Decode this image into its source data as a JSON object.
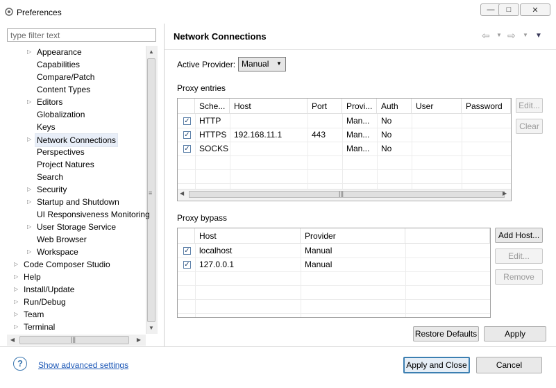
{
  "window": {
    "title": "Preferences",
    "minimize_glyph": "—",
    "maximize_glyph": "□",
    "close_glyph": "✕"
  },
  "filter": {
    "placeholder": "type filter text"
  },
  "tree": {
    "items": [
      {
        "label": "Appearance",
        "expandable": true,
        "level": 1
      },
      {
        "label": "Capabilities",
        "expandable": false,
        "level": 1
      },
      {
        "label": "Compare/Patch",
        "expandable": false,
        "level": 1
      },
      {
        "label": "Content Types",
        "expandable": false,
        "level": 1
      },
      {
        "label": "Editors",
        "expandable": true,
        "level": 1
      },
      {
        "label": "Globalization",
        "expandable": false,
        "level": 1
      },
      {
        "label": "Keys",
        "expandable": false,
        "level": 1
      },
      {
        "label": "Network Connections",
        "expandable": true,
        "level": 1,
        "selected": true
      },
      {
        "label": "Perspectives",
        "expandable": false,
        "level": 1
      },
      {
        "label": "Project Natures",
        "expandable": false,
        "level": 1
      },
      {
        "label": "Search",
        "expandable": false,
        "level": 1
      },
      {
        "label": "Security",
        "expandable": true,
        "level": 1
      },
      {
        "label": "Startup and Shutdown",
        "expandable": true,
        "level": 1
      },
      {
        "label": "UI Responsiveness Monitoring",
        "expandable": false,
        "level": 1
      },
      {
        "label": "User Storage Service",
        "expandable": true,
        "level": 1
      },
      {
        "label": "Web Browser",
        "expandable": false,
        "level": 1
      },
      {
        "label": "Workspace",
        "expandable": true,
        "level": 1
      },
      {
        "label": "Code Composer Studio",
        "expandable": true,
        "level": 0
      },
      {
        "label": "Help",
        "expandable": true,
        "level": 0
      },
      {
        "label": "Install/Update",
        "expandable": true,
        "level": 0
      },
      {
        "label": "Run/Debug",
        "expandable": true,
        "level": 0
      },
      {
        "label": "Team",
        "expandable": true,
        "level": 0
      },
      {
        "label": "Terminal",
        "expandable": true,
        "level": 0
      }
    ]
  },
  "page": {
    "title": "Network Connections",
    "active_provider_label": "Active Provider:",
    "active_provider_value": "Manual",
    "proxy_entries_label": "Proxy entries",
    "proxy_entries": {
      "columns": [
        "Sche...",
        "Host",
        "Port",
        "Provi...",
        "Auth",
        "User",
        "Password"
      ],
      "rows": [
        {
          "checked": true,
          "scheme": "HTTP",
          "host": "",
          "port": "",
          "provider": "Man...",
          "auth": "No",
          "user": "",
          "password": ""
        },
        {
          "checked": true,
          "scheme": "HTTPS",
          "host": "192.168.11.1",
          "port": "443",
          "provider": "Man...",
          "auth": "No",
          "user": "",
          "password": ""
        },
        {
          "checked": true,
          "scheme": "SOCKS",
          "host": "",
          "port": "",
          "provider": "Man...",
          "auth": "No",
          "user": "",
          "password": ""
        }
      ]
    },
    "entries_buttons": {
      "edit": "Edit...",
      "clear": "Clear"
    },
    "proxy_bypass_label": "Proxy bypass",
    "proxy_bypass": {
      "columns": [
        "Host",
        "Provider"
      ],
      "rows": [
        {
          "checked": true,
          "host": "localhost",
          "provider": "Manual"
        },
        {
          "checked": true,
          "host": "127.0.0.1",
          "provider": "Manual"
        }
      ]
    },
    "bypass_buttons": {
      "add_host": "Add Host...",
      "edit": "Edit...",
      "remove": "Remove"
    },
    "restore_defaults": "Restore Defaults",
    "apply": "Apply"
  },
  "footer": {
    "help_glyph": "?",
    "advanced_link": "Show advanced settings",
    "apply_and_close": "Apply and Close",
    "cancel": "Cancel"
  },
  "colors": {
    "link": "#1a56b6",
    "primary_border": "#3c7fb1",
    "selection": "#e8eef8"
  }
}
